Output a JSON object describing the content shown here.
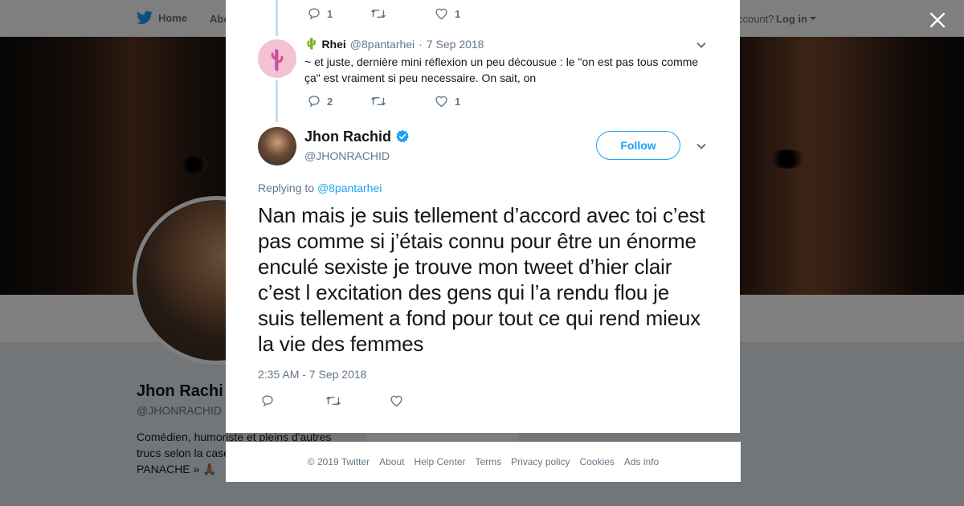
{
  "nav": {
    "home": "Home",
    "about": "Abo",
    "account_prompt": "ccount?",
    "login": "Log in"
  },
  "profile": {
    "name": "Jhon Rachi",
    "handle": "@JHONRACHID",
    "bio": "Comédien, humoriste et pleins d'autres trucs selon la case mais quoi que je f PANACHE » 🙏🏽",
    "ads_label": "Ads info"
  },
  "thread": {
    "prev_tweet_actions": {
      "replies": "1",
      "retweets": "",
      "likes": "1"
    },
    "rhei": {
      "emoji": "🌵",
      "name": "Rhei",
      "handle": "@8pantarhei",
      "separator": "·",
      "date": "7 Sep 2018",
      "text": "~ et juste, dernière mini réflexion un peu décousue : le \"on est pas tous comme ça\" est vraiment si peu necessaire. On sait, on",
      "actions": {
        "replies": "2",
        "retweets": "",
        "likes": "1"
      }
    }
  },
  "tweet": {
    "author_name": "Jhon Rachid",
    "author_handle": "@JHONRACHID",
    "follow_label": "Follow",
    "replying_prefix": "Replying to ",
    "replying_handle": "@8pantarhei",
    "text": "Nan mais je suis tellement d’accord avec toi c’est pas comme si j’étais connu pour être un énorme enculé sexiste je trouve mon tweet d’hier clair c’est l excitation des gens qui l’a rendu flou je suis tellement a fond pour tout ce qui rend mieux la vie des femmes",
    "timestamp": "2:35 AM - 7 Sep 2018"
  },
  "footer": {
    "links": [
      "© 2019 Twitter",
      "About",
      "Help Center",
      "Terms",
      "Privacy policy",
      "Cookies",
      "Ads info"
    ]
  },
  "colors": {
    "accent": "#1da1f2",
    "thread_line": "#c4e1f5",
    "verified": "#1da1f2",
    "muted_text": "#657786"
  },
  "icons": [
    "twitter-bird-icon",
    "close-icon",
    "reply-icon",
    "retweet-icon",
    "like-icon",
    "chevron-down-icon",
    "verified-badge-icon",
    "cactus-icon"
  ]
}
